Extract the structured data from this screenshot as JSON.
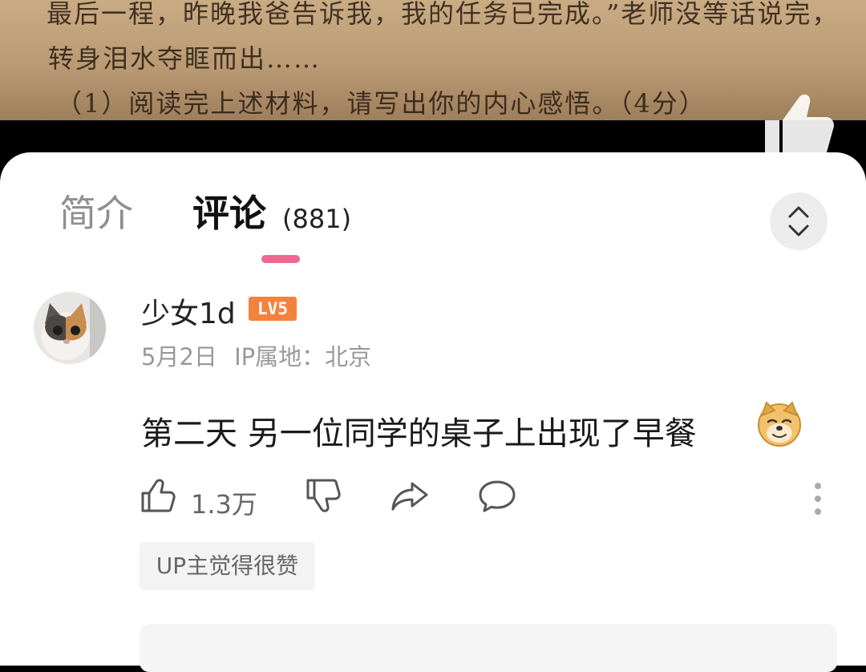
{
  "video": {
    "line1": "最后一程，昨晚我爸告诉我，我的任务已完成。”老师没等话说完，",
    "line2": "转身泪水夺眶而出……",
    "line3": "（1）阅读完上述材料，请写出你的内心感悟。（4分）"
  },
  "tabs": {
    "intro": "简介",
    "comments": "评论",
    "comment_count": "(881)"
  },
  "comment": {
    "username": "少女1d",
    "level": "LV5",
    "date": "5月2日",
    "ip": "IP属地：北京",
    "text": "第二天 另一位同学的桌子上出现了早餐",
    "emoji": "doge-emoji",
    "likes": "1.3万",
    "up_badge": "UP主觉得很赞"
  },
  "colors": {
    "accent_pink": "#f0688f",
    "level_orange": "#f5823b"
  }
}
